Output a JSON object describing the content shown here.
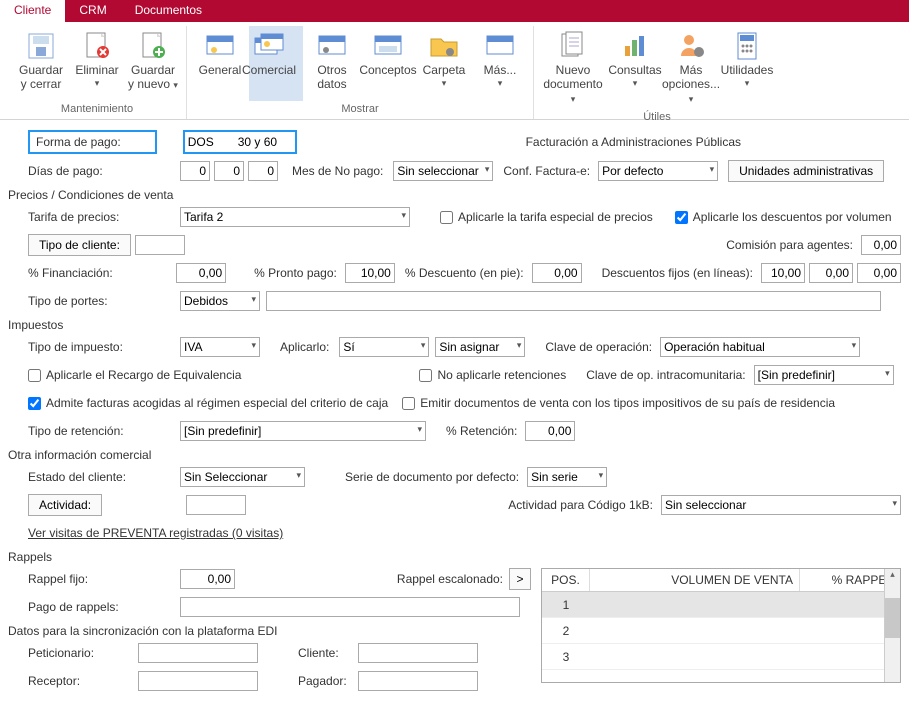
{
  "tabs": [
    "Cliente",
    "CRM",
    "Documentos"
  ],
  "ribbon": {
    "g1": {
      "cap": "Mantenimiento",
      "b": [
        [
          "Guardar",
          "y cerrar"
        ],
        [
          "Eliminar"
        ],
        [
          "Guardar",
          "y nuevo"
        ]
      ]
    },
    "g2": {
      "cap": "Mostrar",
      "b": [
        [
          "General"
        ],
        [
          "Comercial"
        ],
        [
          "Otros",
          "datos"
        ],
        [
          "Conceptos"
        ],
        [
          "Carpeta"
        ],
        [
          "Más..."
        ]
      ]
    },
    "g3": {
      "cap": "Útiles",
      "b": [
        [
          "Nuevo",
          "documento"
        ],
        [
          "Consultas"
        ],
        [
          "Más",
          "opciones..."
        ],
        [
          "Utilidades"
        ]
      ]
    }
  },
  "forma_pago": {
    "label": "Forma de pago:",
    "code": "DOS",
    "desc": "30 y 60"
  },
  "fact_admin": "Facturación a Administraciones Públicas",
  "dias_pago": {
    "label": "Días de pago:",
    "d1": "0",
    "d2": "0",
    "d3": "0"
  },
  "mes_no_pago": {
    "label": "Mes de No pago:",
    "val": "Sin seleccionar"
  },
  "conf_fe": {
    "label": "Conf. Factura-e:",
    "val": "Por defecto"
  },
  "unidades_admin": "Unidades administrativas",
  "sec_precios": "Precios / Condiciones de venta",
  "tarifa": {
    "label": "Tarifa de precios:",
    "val": "Tarifa 2"
  },
  "chk_tarifa_esp": "Aplicarle la tarifa especial de precios",
  "chk_desc_vol": "Aplicarle los descuentos por volumen",
  "tipo_cliente": "Tipo de cliente:",
  "comision": {
    "label": "Comisión para agentes:",
    "val": "0,00"
  },
  "pct_fin": {
    "label": "% Financiación:",
    "val": "0,00"
  },
  "pct_pp": {
    "label": "% Pronto pago:",
    "val": "10,00"
  },
  "pct_desc": {
    "label": "% Descuento (en pie):",
    "val": "0,00"
  },
  "desc_fijos": {
    "label": "Descuentos fijos (en líneas):",
    "v1": "10,00",
    "v2": "0,00",
    "v3": "0,00"
  },
  "tipo_portes": {
    "label": "Tipo de portes:",
    "val": "Debidos"
  },
  "sec_imp": "Impuestos",
  "tipo_imp": {
    "label": "Tipo de impuesto:",
    "val": "IVA"
  },
  "aplicarlo": {
    "label": "Aplicarlo:",
    "val": "Sí",
    "val2": "Sin asignar"
  },
  "clave_op": {
    "label": "Clave de operación:",
    "val": "Operación habitual"
  },
  "chk_recargo": "Aplicarle el Recargo de Equivalencia",
  "chk_no_ret": "No aplicarle retenciones",
  "clave_intra": {
    "label": "Clave de op. intracomunitaria:",
    "val": "[Sin predefinir]"
  },
  "chk_reg_caja": "Admite facturas acogidas al régimen especial del criterio de caja",
  "chk_emitir": "Emitir documentos de venta con los tipos impositivos de su país de residencia",
  "tipo_ret": {
    "label": "Tipo de retención:",
    "val": "[Sin predefinir]"
  },
  "pct_ret": {
    "label": "% Retención:",
    "val": "0,00"
  },
  "sec_otra": "Otra información comercial",
  "estado": {
    "label": "Estado del cliente:",
    "val": "Sin Seleccionar"
  },
  "serie_doc": {
    "label": "Serie de documento por defecto:",
    "val": "Sin serie"
  },
  "actividad": "Actividad:",
  "act_1kb": {
    "label": "Actividad para Código 1kB:",
    "val": "Sin seleccionar"
  },
  "visitas": "Ver visitas de PREVENTA registradas (0 visitas)",
  "sec_rappels": "Rappels",
  "rappel_fijo": {
    "label": "Rappel fijo:",
    "val": "0,00"
  },
  "rappel_esc": "Rappel escalonado:",
  "pago_rappels": "Pago de rappels:",
  "sec_edi": "Datos para la sincronización con la plataforma EDI",
  "edi": {
    "pet": "Peticionario:",
    "cli": "Cliente:",
    "rec": "Receptor:",
    "pag": "Pagador:"
  },
  "table": {
    "h": [
      "POS.",
      "VOLUMEN DE VENTA",
      "% RAPPEL"
    ],
    "rows": [
      "1",
      "2",
      "3"
    ]
  },
  "chart_data": null
}
